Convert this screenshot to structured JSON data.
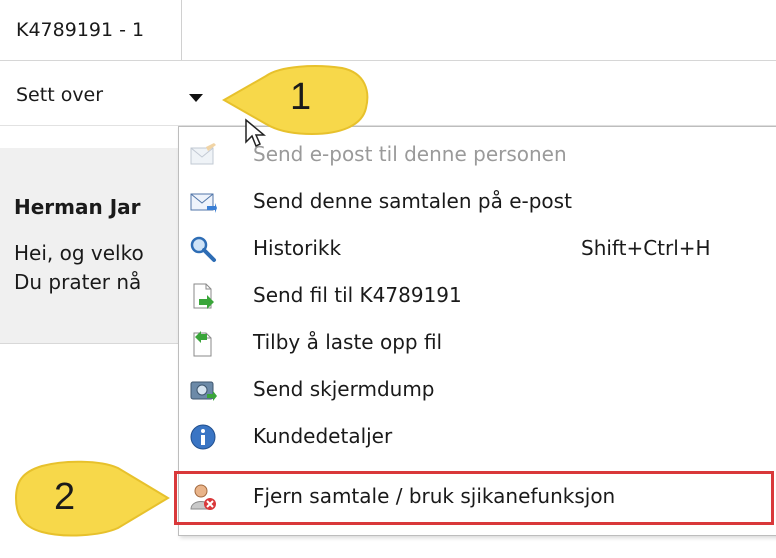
{
  "tab": {
    "title": "K4789191 - 1"
  },
  "toolbar": {
    "transfer_label": "Sett over"
  },
  "chat": {
    "name": "Herman Jar",
    "lines": [
      "Hei, og velko",
      "Du prater nå"
    ]
  },
  "menu": {
    "items": [
      {
        "label": "Send e-post til denne personen",
        "icon": "email-edit-icon",
        "disabled": true
      },
      {
        "label": "Send denne samtalen på e-post",
        "icon": "email-send-icon"
      },
      {
        "label": "Historikk",
        "icon": "magnifier-icon",
        "shortcut": "Shift+Ctrl+H"
      },
      {
        "label": "Send fil til K4789191",
        "icon": "file-send-icon"
      },
      {
        "label": "Tilby å laste opp fil",
        "icon": "file-upload-icon"
      },
      {
        "label": "Send skjermdump",
        "icon": "screenshot-icon"
      },
      {
        "label": "Kundedetaljer",
        "icon": "info-icon"
      },
      {
        "label": "Fjern samtale / bruk sjikanefunksjon",
        "icon": "remove-user-icon"
      }
    ]
  },
  "callouts": {
    "one": "1",
    "two": "2"
  },
  "colors": {
    "callout_fill": "#f7d84a",
    "highlight_border": "#d9383a"
  }
}
